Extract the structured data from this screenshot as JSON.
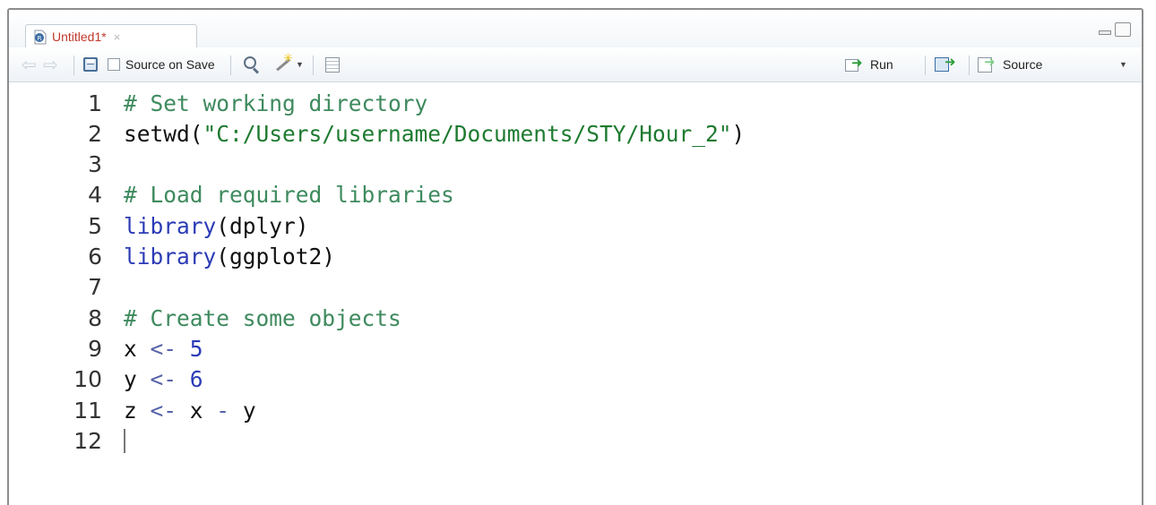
{
  "tab": {
    "title": "Untitled1*",
    "close": "×"
  },
  "toolbar": {
    "source_on_save": "Source on Save",
    "run": "Run",
    "source": "Source",
    "caret": "▼"
  },
  "editor": {
    "lines": [
      {
        "n": "1",
        "tokens": [
          {
            "t": "# Set working directory",
            "c": "cm"
          }
        ]
      },
      {
        "n": "2",
        "tokens": [
          {
            "t": "setwd(",
            "c": "id"
          },
          {
            "t": "\"C:/Users/username/Documents/STY/Hour_2\"",
            "c": "st"
          },
          {
            "t": ")",
            "c": "id"
          }
        ]
      },
      {
        "n": "3",
        "tokens": []
      },
      {
        "n": "4",
        "tokens": [
          {
            "t": "# Load required libraries",
            "c": "cm"
          }
        ]
      },
      {
        "n": "5",
        "tokens": [
          {
            "t": "library",
            "c": "fn"
          },
          {
            "t": "(dplyr)",
            "c": "id"
          }
        ]
      },
      {
        "n": "6",
        "tokens": [
          {
            "t": "library",
            "c": "fn"
          },
          {
            "t": "(ggplot2)",
            "c": "id"
          }
        ]
      },
      {
        "n": "7",
        "tokens": []
      },
      {
        "n": "8",
        "tokens": [
          {
            "t": "# Create some objects",
            "c": "cm"
          }
        ]
      },
      {
        "n": "9",
        "tokens": [
          {
            "t": "x ",
            "c": "id"
          },
          {
            "t": "<-",
            "c": "op"
          },
          {
            "t": " ",
            "c": "id"
          },
          {
            "t": "5",
            "c": "nm"
          }
        ]
      },
      {
        "n": "10",
        "tokens": [
          {
            "t": "y ",
            "c": "id"
          },
          {
            "t": "<-",
            "c": "op"
          },
          {
            "t": " ",
            "c": "id"
          },
          {
            "t": "6",
            "c": "nm"
          }
        ]
      },
      {
        "n": "11",
        "tokens": [
          {
            "t": "z ",
            "c": "id"
          },
          {
            "t": "<-",
            "c": "op"
          },
          {
            "t": " x ",
            "c": "id"
          },
          {
            "t": "-",
            "c": "op"
          },
          {
            "t": " y",
            "c": "id"
          }
        ]
      },
      {
        "n": "12",
        "tokens": []
      }
    ]
  }
}
